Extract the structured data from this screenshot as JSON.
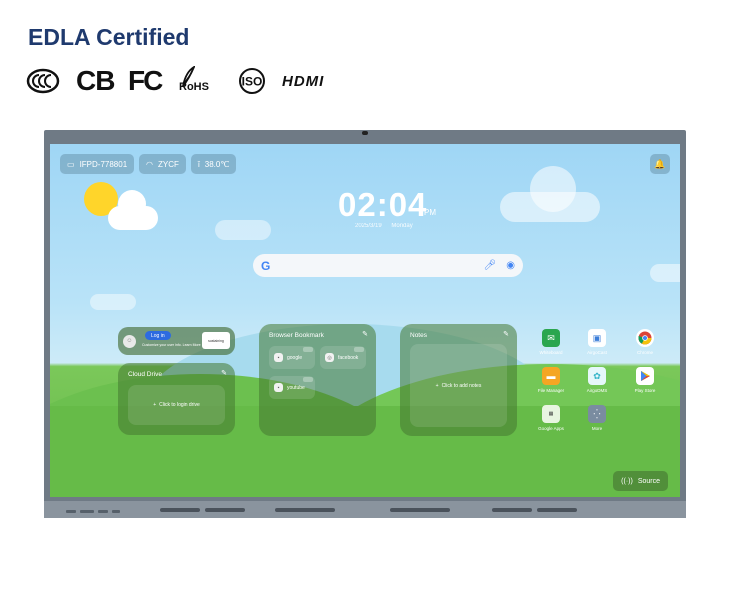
{
  "heading": "EDLA Certified",
  "certifications": {
    "ccc": "CCC",
    "cb": "CB",
    "fc": "FC",
    "rohs": "RoHS",
    "iso": "ISO",
    "hdmi": "HDMI"
  },
  "status_bar": {
    "device": "IFPD-778801",
    "network": "ZYCF",
    "temperature": "38.0℃"
  },
  "clock": {
    "time": "02:04",
    "ampm": "PM",
    "date": "2025/3/19",
    "weekday": "Monday"
  },
  "account_widget": {
    "login_label": "Log in",
    "note": "Customize your user info. Learn More",
    "logo": "sustaining"
  },
  "cloud_drive": {
    "title": "Cloud Drive",
    "action": "Click to login drive"
  },
  "bookmarks": {
    "title": "Browser Bookmark",
    "items": [
      {
        "label": "google"
      },
      {
        "label": "facebook"
      },
      {
        "label": "youtube"
      }
    ]
  },
  "notes": {
    "title": "Notes",
    "action": "Click to add notes"
  },
  "apps": [
    {
      "label": "Whiteboard",
      "icon": "whiteboard-icon",
      "color": "#2aa64f"
    },
    {
      "label": "AirgoCast",
      "icon": "cast-icon",
      "color": "#3b7dd8"
    },
    {
      "label": "Chrome",
      "icon": "chrome-icon",
      "color": "#ffffff"
    },
    {
      "label": "File Manager",
      "icon": "folder-icon",
      "color": "#f5a623"
    },
    {
      "label": "AirgoDMS",
      "icon": "dms-icon",
      "color": "#36b5c8"
    },
    {
      "label": "Play Store",
      "icon": "play-store-icon",
      "color": "#ffffff"
    },
    {
      "label": "Google Apps",
      "icon": "google-apps-icon",
      "color": "#e8f5e0"
    },
    {
      "label": "More",
      "icon": "grid-icon",
      "color": "#7a8ca0"
    }
  ],
  "source_button": "Source",
  "colors": {
    "heading": "#1f3a6e",
    "sky": "#9fd6f5",
    "grass": "#66bb48",
    "login_button": "#2d6be0"
  }
}
